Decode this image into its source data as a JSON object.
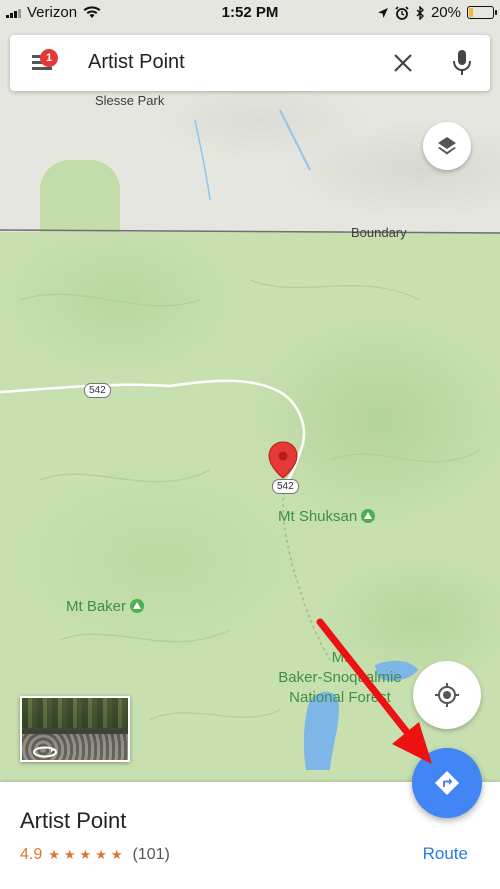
{
  "status_bar": {
    "carrier": "Verizon",
    "time": "1:52 PM",
    "battery": "20%",
    "battery_level": 0.2
  },
  "search": {
    "query": "Artist Point",
    "menu_badge": "1",
    "icons": [
      "menu-icon",
      "clear-icon",
      "mic-icon"
    ]
  },
  "map": {
    "labels": {
      "slesse_park": "Slesse Park",
      "boundary": "Boundary",
      "mt_shuksan": "Mt Shuksan",
      "mt_baker": "Mt Baker",
      "forest_line1": "Mt",
      "forest_line2": "Baker-Snoqualmie",
      "forest_line3": "National Forest"
    },
    "route_badges": {
      "west": "542",
      "pin": "542"
    },
    "buttons": [
      "layers-icon",
      "my-location-icon",
      "directions-icon"
    ]
  },
  "place": {
    "name": "Artist Point",
    "rating": "4.9",
    "stars": "★★★★★",
    "review_count": "(101)",
    "route_label": "Route"
  },
  "colors": {
    "accent_blue": "#4285f4",
    "route_blue": "#2a7be4",
    "rating_orange": "#e0742e",
    "pin_red": "#e53935",
    "annotation_red": "#ee1111"
  }
}
